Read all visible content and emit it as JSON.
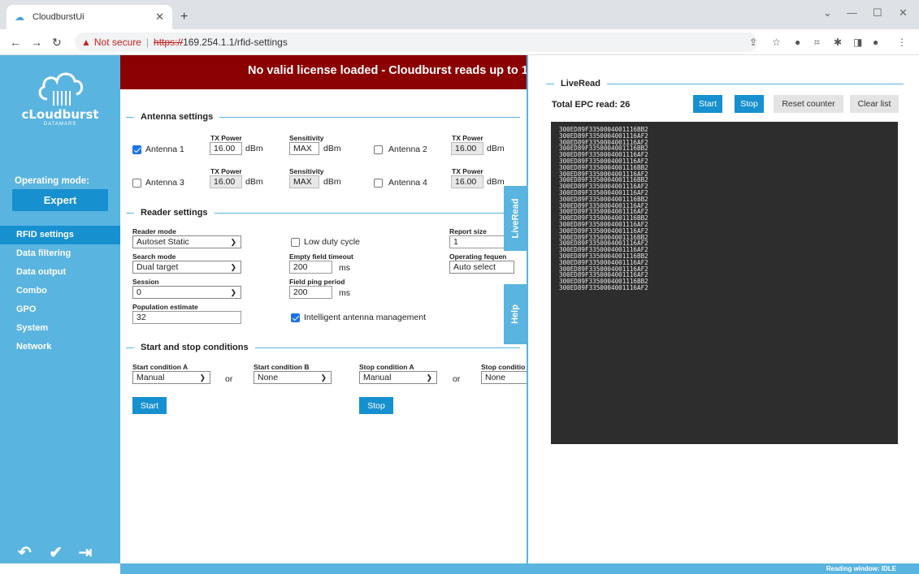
{
  "browser": {
    "tab_title": "CloudburstUi",
    "new_tab": "+",
    "address_warning": "Not secure",
    "address_scheme": "https://",
    "address_rest": "169.254.1.1/rfid-settings"
  },
  "sidebar": {
    "logo_word": "cLoudburst",
    "logo_sub": "DATAMARS",
    "operating_mode_label": "Operating mode:",
    "operating_mode_value": "Expert",
    "items": [
      {
        "label": "RFID settings"
      },
      {
        "label": "Data filtering"
      },
      {
        "label": "Data output"
      },
      {
        "label": "Combo"
      },
      {
        "label": "GPO"
      },
      {
        "label": "System"
      },
      {
        "label": "Network"
      }
    ]
  },
  "banner": "No valid license loaded - Cloudburst reads up to 1(",
  "antenna": {
    "title": "Antenna settings",
    "tx_power_label": "TX Power",
    "sensitivity_label": "Sensitivity",
    "unit_dbm": "dBm",
    "antennas": [
      {
        "name": "Antenna 1",
        "checked": true,
        "tx": "16.00",
        "sens": "MAX"
      },
      {
        "name": "Antenna 2",
        "checked": false,
        "tx": "16.00"
      },
      {
        "name": "Antenna 3",
        "checked": false,
        "tx": "16.00",
        "sens": "MAX"
      },
      {
        "name": "Antenna 4",
        "checked": false,
        "tx": "16.00"
      }
    ]
  },
  "reader": {
    "title": "Reader settings",
    "reader_mode_label": "Reader mode",
    "reader_mode_value": "Autoset Static",
    "search_mode_label": "Search mode",
    "search_mode_value": "Dual target",
    "session_label": "Session",
    "session_value": "0",
    "population_label": "Population estimate",
    "population_value": "32",
    "low_duty_label": "Low duty cycle",
    "empty_timeout_label": "Empty field timeout",
    "empty_timeout_value": "200",
    "field_ping_label": "Field ping period",
    "field_ping_value": "200",
    "ms": "ms",
    "intelligent_label": "Intelligent antenna management",
    "report_size_label": "Report size",
    "report_size_value": "1",
    "op_freq_label": "Operating fequen",
    "op_freq_value": "Auto select"
  },
  "conditions": {
    "title": "Start and stop conditions",
    "start_a_label": "Start condition A",
    "start_a_value": "Manual",
    "or": "or",
    "start_b_label": "Start condition B",
    "start_b_value": "None",
    "stop_a_label": "Stop condition A",
    "stop_a_value": "Manual",
    "stop_b_label": "Stop conditio",
    "stop_b_value": "None",
    "start_button": "Start",
    "stop_button": "Stop"
  },
  "side_tabs": {
    "liveread": "LiveRead",
    "help": "Help"
  },
  "live": {
    "title": "LiveRead",
    "total_label": "Total EPC read: 26",
    "start": "Start",
    "stop": "Stop",
    "reset": "Reset counter",
    "clear": "Clear list",
    "epcs": [
      "300ED89F3350004001116BB2",
      "300ED89F3350004001116AF2",
      "300ED89F3350004001116AF2",
      "300ED89F3350004001116BB2",
      "300ED89F3350004001116AF2",
      "300ED89F3350004001116AF2",
      "300ED89F3350004001116BB2",
      "300ED89F3350004001116AF2",
      "300ED89F3350004001116BB2",
      "300ED89F3350004001116AF2",
      "300ED89F3350004001116AF2",
      "300ED89F3350004001116BB2",
      "300ED89F3350004001116AF2",
      "300ED89F3350004001116AF2",
      "300ED89F3350004001116BB2",
      "300ED89F3350004001116AF2",
      "300ED89F3350004001116AF2",
      "300ED89F3350004001116BB2",
      "300ED89F3350004001116AF2",
      "300ED89F3350004001116AF2",
      "300ED89F3350004001116BB2",
      "300ED89F3350004001116AF2",
      "300ED89F3350004001116AF2",
      "300ED89F3350004001116AF2",
      "300ED89F3350004001116BB2",
      "300ED89F3350004001116AF2"
    ]
  },
  "footer": "Reading window: IDLE"
}
